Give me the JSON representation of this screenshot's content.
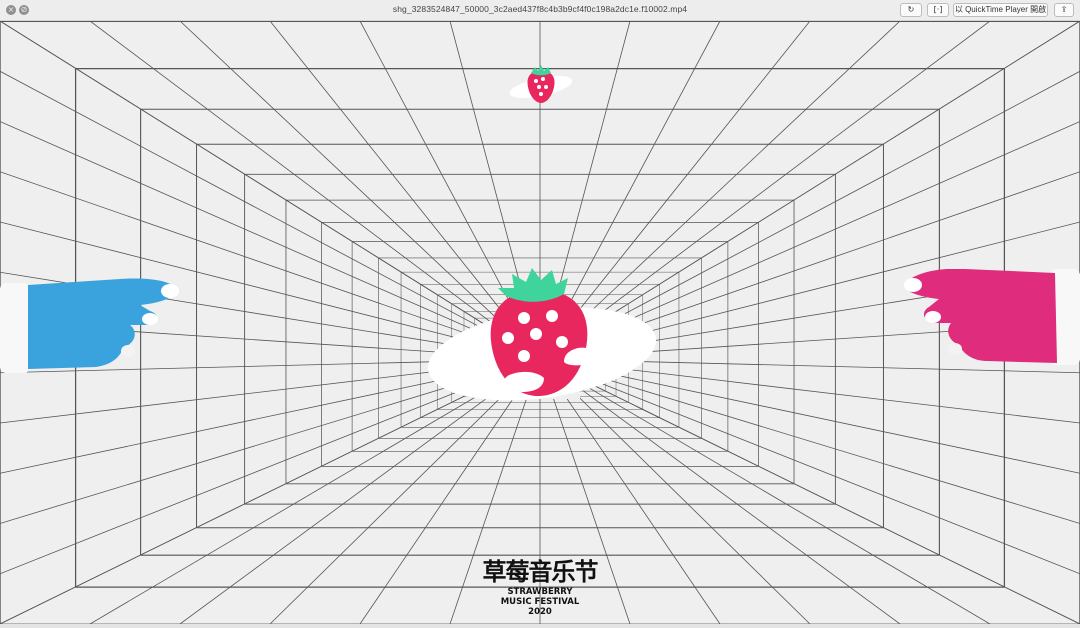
{
  "window": {
    "filename": "shg_3283524847_50000_3c2aed437f8c4b3b9cf4f0c198a2dc1e.f10002.mp4",
    "controls": {
      "close_icon": "×",
      "minimize_icon": "⊘"
    }
  },
  "toolbar": {
    "rotate_icon": "↻",
    "trim_icon": "[·]",
    "open_qt_label": "以 QuickTime Player 開啟",
    "share_icon": "⇪"
  },
  "video": {
    "festival_title_cn": "草莓音乐节",
    "festival_title_en_line1": "STRAWBERRY",
    "festival_title_en_line2": "MUSIC FESTIVAL",
    "festival_year": "2020",
    "colors": {
      "strawberry_red": "#e8275f",
      "leaf_green": "#3fd49b",
      "left_glove": "#3aa3dd",
      "right_glove": "#df2c7c",
      "grid_line": "#555555",
      "background": "#efefef"
    }
  }
}
